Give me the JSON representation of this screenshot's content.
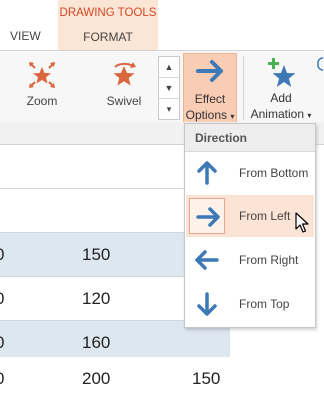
{
  "tabs": {
    "view": "VIEW",
    "contextual_group": "DRAWING TOOLS",
    "format": "FORMAT"
  },
  "ribbon": {
    "gallery": [
      {
        "label": "Zoom",
        "icon": "zoom-effect-icon"
      },
      {
        "label": "Swivel",
        "icon": "swivel-effect-icon"
      }
    ],
    "gallery_scroll": {
      "up": "▲",
      "down": "▼",
      "more": "▾"
    },
    "effect_options": {
      "line1": "Effect",
      "line2": "Options",
      "caret": "▾",
      "icon": "arrow-right-icon"
    },
    "add_animation": {
      "line1": "Add",
      "line2": "Animation",
      "caret": "▾",
      "icon": "star-plus-icon"
    }
  },
  "sheet": {
    "rows": [
      {
        "style": "white",
        "cells": []
      },
      {
        "style": "white",
        "cells": []
      },
      {
        "style": "blue",
        "cells": [
          "0",
          "150",
          ""
        ]
      },
      {
        "style": "white",
        "cells": [
          "0",
          "120",
          ""
        ]
      },
      {
        "style": "blue",
        "cells": [
          "0",
          "160",
          ""
        ]
      },
      {
        "style": "white",
        "cells": [
          "0",
          "200",
          "150"
        ]
      }
    ]
  },
  "dropdown": {
    "header": "Direction",
    "items": [
      {
        "label": "From Bottom",
        "icon": "arrow-up-icon",
        "selected": false
      },
      {
        "label": "From Left",
        "icon": "arrow-right-icon",
        "selected": true
      },
      {
        "label": "From Right",
        "icon": "arrow-left-icon",
        "selected": false
      },
      {
        "label": "From Top",
        "icon": "arrow-down-icon",
        "selected": false
      }
    ]
  },
  "colors": {
    "accent_orange": "#d24726",
    "arrow_blue": "#3c79b6",
    "selection_bg": "#fbe3d6",
    "table_band": "#dde7f0"
  }
}
